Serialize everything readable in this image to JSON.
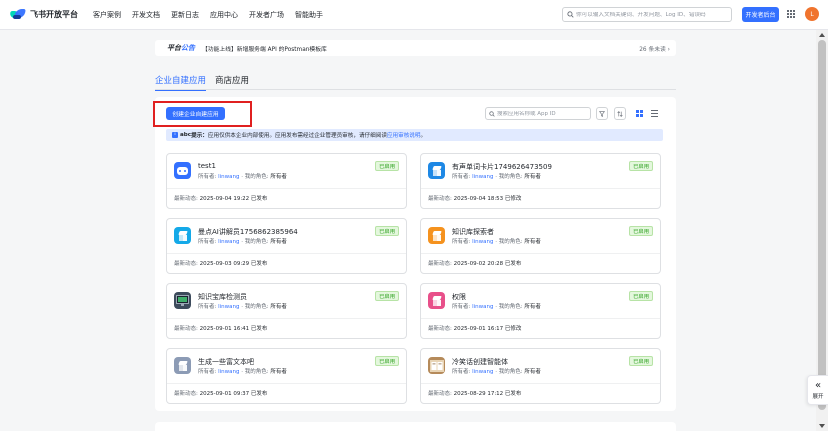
{
  "header": {
    "brand": "飞书开放平台",
    "nav": [
      "客户案例",
      "开发文档",
      "更新日志",
      "应用中心",
      "开发者广场",
      "智能助手"
    ],
    "search_placeholder": "你可以输入文档关键词、开发问题、Log ID、错误码",
    "dev_console": "开发者后台",
    "avatar_initial": "L"
  },
  "announcement": {
    "tag_a": "平台",
    "tag_b": "公告",
    "text": "【功能上线】新增服务端 API 的Postman模板库",
    "unread": "26 条未读 ›"
  },
  "tabs": [
    "企业自建应用",
    "商店应用"
  ],
  "toolbar": {
    "create_label": "创建企业自建应用",
    "search_placeholder": "搜索应用名称或 App ID"
  },
  "notice": {
    "brand": "abc",
    "prefix": "提示：",
    "text": "应用仅供本企业内部使用。应用发布需经过企业管理员审核，请仔细阅读",
    "link": "应用审核说明",
    "suffix": "。"
  },
  "labels": {
    "owner": "所有者:",
    "my_role": "我的角色:",
    "latest": "最新动态:",
    "sep": "·"
  },
  "apps": [
    {
      "name": "test1",
      "owner": "linwang",
      "role": "所有者",
      "status": "已启用",
      "updated": "2025-09-04 19:22 已发布",
      "icon": "robot-icon",
      "color": "#3370ff"
    },
    {
      "name": "有声单词卡片1749626473509",
      "owner": "linwang",
      "role": "所有者",
      "status": "已启用",
      "updated": "2025-09-04 18:53 已修改",
      "icon": "cube-icon",
      "color": "#1e88e5"
    },
    {
      "name": "曼点AI讲解员1756862385964",
      "owner": "linwang",
      "role": "所有者",
      "status": "已启用",
      "updated": "2025-09-03 09:29 已发布",
      "icon": "cube-icon",
      "color": "#14a9e8"
    },
    {
      "name": "知识库探索者",
      "owner": "linwang",
      "role": "所有者",
      "status": "已启用",
      "updated": "2025-09-02 20:28 已发布",
      "icon": "cube-icon",
      "color": "#f5921e"
    },
    {
      "name": "知识宝库检测员",
      "owner": "linwang",
      "role": "所有者",
      "status": "已启用",
      "updated": "2025-09-01 16:41 已发布",
      "icon": "monitor-icon",
      "color": "#3d4b5c"
    },
    {
      "name": "权限",
      "owner": "linwang",
      "role": "所有者",
      "status": "已启用",
      "updated": "2025-09-01 16:17 已修改",
      "icon": "cube-icon",
      "color": "#e8508a"
    },
    {
      "name": "生成一些富文本吧",
      "owner": "linwang",
      "role": "所有者",
      "status": "已启用",
      "updated": "2025-09-01 09:37 已发布",
      "icon": "cube-icon",
      "color": "#8c9bb5"
    },
    {
      "name": "冷笑话创建智能体",
      "owner": "linwang",
      "role": "所有者",
      "status": "已启用",
      "updated": "2025-08-29 17:12 已发布",
      "icon": "book-icon",
      "color": "#b58a5a"
    }
  ],
  "side": {
    "expand": "展开"
  }
}
